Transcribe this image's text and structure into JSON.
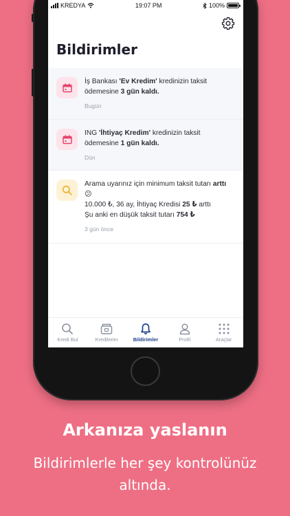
{
  "status_bar": {
    "carrier": "KREDYA",
    "time": "19:07 PM",
    "battery": "100%"
  },
  "header": {
    "title": "Bildirimler",
    "settings_icon": "gear-icon"
  },
  "notifications": [
    {
      "icon": "calendar-icon",
      "pre": "İş Bankası ",
      "bold1": "'Ev Kredim'",
      "mid": " kredinizin taksit ödemesine ",
      "bold2": "3 gün kaldı.",
      "time": "Bugün"
    },
    {
      "icon": "calendar-icon",
      "pre": "ING ",
      "bold1": "'İhtiyaç Kredim'",
      "mid": " kredinizin taksit ödemesine ",
      "bold2": "1 gün kaldı.",
      "time": "Dün"
    },
    {
      "icon": "search-icon",
      "line1": "Arama uyarınız için minimum taksit tutarı ",
      "line1_bold": "arttı",
      "emoji": "😕",
      "line2_pre": "10.000 ₺, 36 ay, İhtiyaç Kredisi ",
      "line2_bold": "25 ₺",
      "line2_post": " arttı",
      "line3_pre": "Şu anki en düşük taksit tutarı ",
      "line3_bold": "754 ₺",
      "time": "3 gün önce"
    }
  ],
  "tabs": [
    {
      "label": "Kredi Bul",
      "icon": "search-icon"
    },
    {
      "label": "Kredilerim",
      "icon": "wallet-icon"
    },
    {
      "label": "Bildirimler",
      "icon": "bell-icon",
      "active": true
    },
    {
      "label": "Profil",
      "icon": "user-icon"
    },
    {
      "label": "Araçlar",
      "icon": "grid-icon"
    }
  ],
  "colors": {
    "background": "#ee6f84",
    "active_tab": "#1f3e8c",
    "calendar_icon": "#e5446d",
    "search_icon": "#f0b43a"
  },
  "promo": {
    "headline": "Arkanıza yaslanın",
    "subline": "Bildirimlerle her şey kontrolünüz altında."
  }
}
